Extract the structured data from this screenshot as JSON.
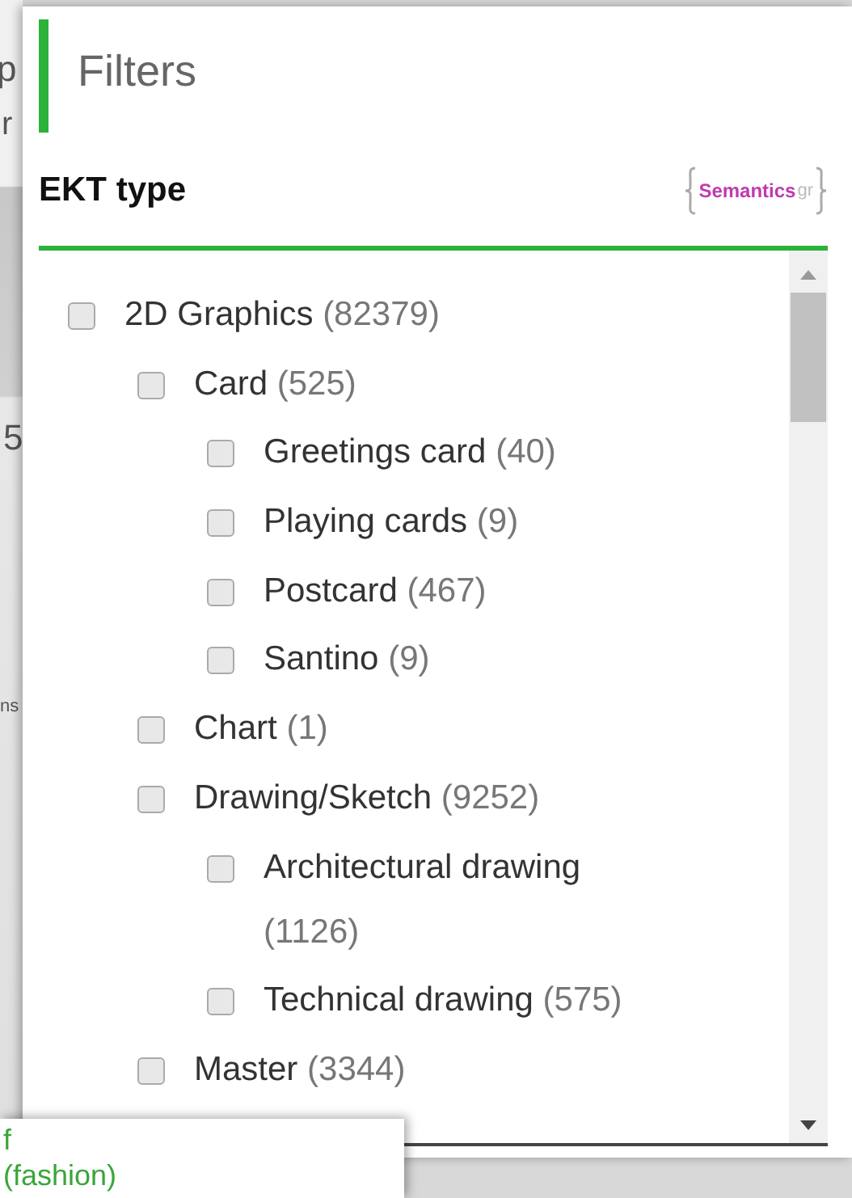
{
  "background_fragments": [
    {
      "text": "p",
      "kind": "top"
    },
    {
      "text": "r",
      "kind": "top"
    },
    {
      "text": "5",
      "kind": "middle"
    },
    {
      "text": "ns",
      "kind": "middle"
    }
  ],
  "panel": {
    "title": "Filters",
    "section": "EKT type",
    "logo": {
      "name": "Semantics",
      "suffix": "gr"
    },
    "tree": [
      {
        "label": "2D Graphics",
        "count": "(82379)",
        "checked": false,
        "children": [
          {
            "label": "Card",
            "count": "(525)",
            "checked": false,
            "children": [
              {
                "label": "Greetings card",
                "count": "(40)",
                "checked": false
              },
              {
                "label": "Playing cards",
                "count": "(9)",
                "checked": false
              },
              {
                "label": "Postcard",
                "count": "(467)",
                "checked": false
              },
              {
                "label": "Santino",
                "count": "(9)",
                "checked": false
              }
            ]
          },
          {
            "label": "Chart",
            "count": "(1)",
            "checked": false
          },
          {
            "label": "Drawing/Sketch",
            "count": "(9252)",
            "checked": false,
            "children": [
              {
                "label": "Architectural drawing",
                "count": "(1126)",
                "checked": false
              },
              {
                "label": "Technical drawing",
                "count": "(575)",
                "checked": false
              }
            ]
          },
          {
            "label": "Master",
            "count": "(3344)",
            "checked": false
          }
        ]
      }
    ]
  },
  "overlay": {
    "lines": [
      "f",
      "(fashion)"
    ]
  }
}
